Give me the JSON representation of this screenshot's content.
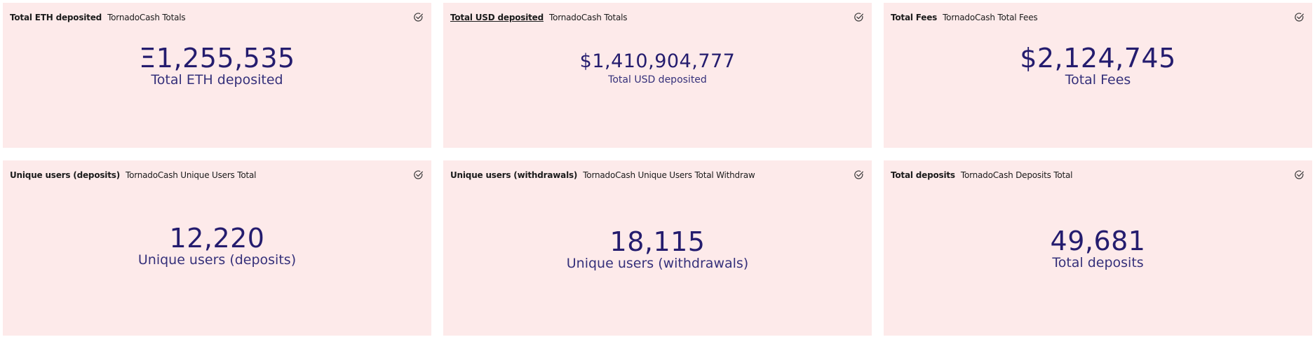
{
  "cards": [
    {
      "title": "Total ETH deposited",
      "subtitle": "TornadoCash Totals",
      "value": "Ξ1,255,535",
      "label": "Total ETH deposited",
      "check_icon": "check-circle-icon"
    },
    {
      "title": "Total USD deposited",
      "subtitle": "TornadoCash Totals",
      "value": "$1,410,904,777",
      "label": "Total USD deposited",
      "check_icon": "check-circle-icon"
    },
    {
      "title": "Total Fees",
      "subtitle": "TornadoCash Total Fees",
      "value": "$2,124,745",
      "label": "Total Fees",
      "check_icon": "check-circle-icon"
    },
    {
      "title": "Unique users (deposits)",
      "subtitle": "TornadoCash Unique Users Total",
      "value": "12,220",
      "label": "Unique users (deposits)",
      "check_icon": "check-circle-icon"
    },
    {
      "title": "Unique users (withdrawals)",
      "subtitle": "TornadoCash Unique Users Total Withdraw",
      "value": "18,115",
      "label": "Unique users (withdrawals)",
      "check_icon": "check-circle-icon"
    },
    {
      "title": "Total deposits",
      "subtitle": "TornadoCash Deposits Total",
      "value": "49,681",
      "label": "Total deposits",
      "check_icon": "check-circle-icon"
    }
  ],
  "colors": {
    "card_background": "#fdeaea",
    "value_text": "#241c6e",
    "label_text": "#35307a",
    "header_text": "#1b1b1b"
  }
}
